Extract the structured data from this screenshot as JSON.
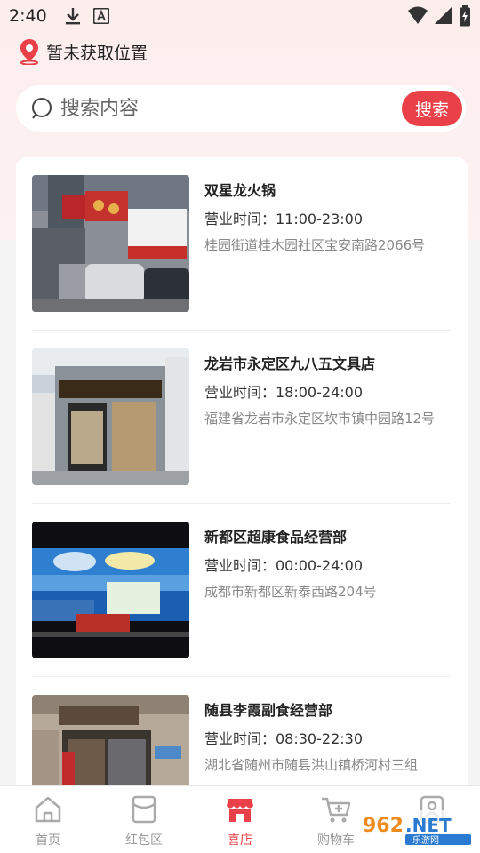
{
  "status_bar": {
    "time": "2:40"
  },
  "location": {
    "text": "暂未获取位置"
  },
  "search": {
    "placeholder": "搜索内容",
    "button_label": "搜索"
  },
  "stores": [
    {
      "name": "双星龙火锅",
      "hours": "营业时间：11:00-23:00",
      "address": "桂园街道桂木园社区宝安南路2066号"
    },
    {
      "name": "龙岩市永定区九八五文具店",
      "hours": "营业时间：18:00-24:00",
      "address": "福建省龙岩市永定区坎市镇中园路12号"
    },
    {
      "name": "新都区超康食品经营部",
      "hours": "营业时间：00:00-24:00",
      "address": "成都市新都区新泰西路204号"
    },
    {
      "name": "随县李霞副食经营部",
      "hours": "营业时间：08:30-22:30",
      "address": "湖北省随州市随县洪山镇桥河村三组"
    }
  ],
  "tabs": [
    {
      "label": "首页",
      "icon": "home-icon"
    },
    {
      "label": "红包区",
      "icon": "red-envelope-icon"
    },
    {
      "label": "喜店",
      "icon": "store-icon",
      "active": true
    },
    {
      "label": "购物车",
      "icon": "cart-icon"
    },
    {
      "label": "我的",
      "icon": "profile-icon"
    }
  ],
  "watermark": {
    "text": "962.NET",
    "sub": "乐游网"
  },
  "colors": {
    "accent": "#e9404a",
    "bg_top": "#fdeeee",
    "text_muted": "#888888"
  }
}
